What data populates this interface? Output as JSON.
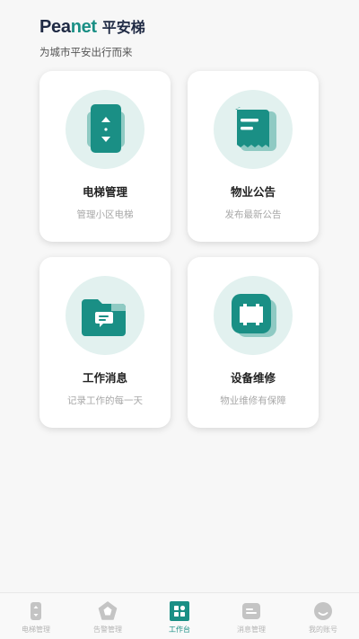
{
  "header": {
    "logo_main": "Pea",
    "logo_accent": "net",
    "title_cn": "平安梯",
    "subtitle": "为城市平安出行而来"
  },
  "cards": [
    {
      "title": "电梯管理",
      "desc": "管理小区电梯",
      "icon": "elevator-icon"
    },
    {
      "title": "物业公告",
      "desc": "发布最新公告",
      "icon": "notice-icon"
    },
    {
      "title": "工作消息",
      "desc": "记录工作的每一天",
      "icon": "message-folder-icon"
    },
    {
      "title": "设备维修",
      "desc": "物业维修有保障",
      "icon": "repair-device-icon"
    }
  ],
  "tabbar": {
    "items": [
      {
        "label": "电梯管理",
        "icon": "elevator-icon",
        "active": false
      },
      {
        "label": "告警管理",
        "icon": "alert-icon",
        "active": false
      },
      {
        "label": "工作台",
        "icon": "workbench-icon",
        "active": true
      },
      {
        "label": "消息管理",
        "icon": "message-icon",
        "active": false
      },
      {
        "label": "我的账号",
        "icon": "account-icon",
        "active": false
      }
    ]
  },
  "colors": {
    "accent": "#1a8f85",
    "accent_light": "#e2f1ef",
    "text_dark": "#1f2a44"
  }
}
